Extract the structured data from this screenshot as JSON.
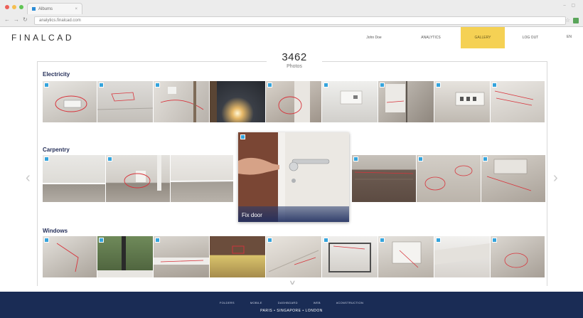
{
  "browser": {
    "tab_title": "Albums",
    "url": "analytics.finalcad.com",
    "colors": {
      "close": "#ec5f57",
      "minimize": "#f5be4f",
      "zoom": "#5fc454"
    }
  },
  "header": {
    "logo": "FINALCAD",
    "nav": [
      {
        "label": "John Doe",
        "active": false
      },
      {
        "label": "ANALYTICS",
        "active": false
      },
      {
        "label": "GALLERY",
        "active": true
      },
      {
        "label": "LOG OUT",
        "active": false
      }
    ],
    "lang": "EN",
    "accent_color": "#f5d154"
  },
  "gallery": {
    "count": "3462",
    "count_label": "Photos",
    "categories": [
      {
        "title": "Electricity",
        "thumbs": 9
      },
      {
        "title": "Carpentry",
        "thumbs": 6
      },
      {
        "title": "Windows",
        "thumbs": 9
      }
    ],
    "featured_caption": "Fix door",
    "tag_color": "#35a4dc",
    "icons": {
      "prev": "chevron-left-icon",
      "next": "chevron-right-icon",
      "more": "chevron-down-icon"
    }
  },
  "footer": {
    "links": [
      "FOLDERS",
      "MOBILE",
      "DASHBOARD",
      "WEB",
      "#CONSTRUCTION"
    ],
    "cities": "PARIS • SINGAPORE • LONDON",
    "background": "#1a2c55"
  }
}
